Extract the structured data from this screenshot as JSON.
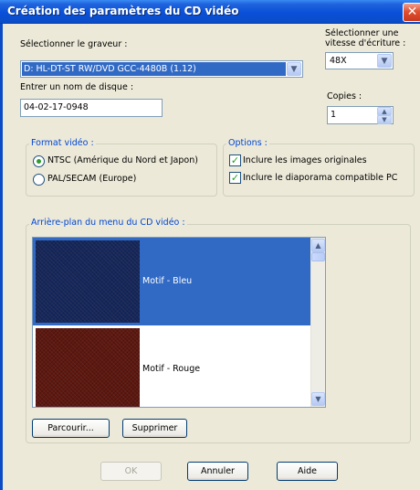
{
  "window": {
    "title": "Création des paramètres du CD vidéo",
    "close_glyph": "✕"
  },
  "burner": {
    "label": "Sélectionner le graveur :",
    "value": "D: HL-DT-ST RW/DVD GCC-4480B (1.12)"
  },
  "speed": {
    "label_line1": "Sélectionner une",
    "label_line2": "vitesse d'écriture :",
    "value": "48X"
  },
  "disc_name": {
    "label": "Entrer un nom de disque :",
    "value": "04-02-17-0948"
  },
  "copies": {
    "label": "Copies :",
    "value": "1"
  },
  "video_format": {
    "title": "Format vidéo :",
    "options": [
      {
        "label": "NTSC (Amérique du Nord et Japon)",
        "selected": true
      },
      {
        "label": "PAL/SECAM (Europe)",
        "selected": false
      }
    ]
  },
  "options": {
    "title": "Options :",
    "items": [
      {
        "label": "Inclure les images originales",
        "checked": true
      },
      {
        "label": "Inclure le diaporama compatible PC",
        "checked": true
      }
    ]
  },
  "background": {
    "title": "Arrière-plan du menu du CD vidéo :",
    "items": [
      {
        "label": "Motif - Bleu",
        "swatch": "blue",
        "selected": true
      },
      {
        "label": "Motif - Rouge",
        "swatch": "red",
        "selected": false
      }
    ],
    "browse_label": "Parcourir...",
    "delete_label": "Supprimer"
  },
  "footer": {
    "ok_label": "OK",
    "cancel_label": "Annuler",
    "help_label": "Aide"
  },
  "glyphs": {
    "down": "▼",
    "up": "▲",
    "check": "✓"
  },
  "colors": {
    "title_bar": "#0b4cc6",
    "dialog_bg": "#ece9d8",
    "group_title": "#0046d5",
    "selection": "#316ac5",
    "close_button": "#e0502f"
  }
}
